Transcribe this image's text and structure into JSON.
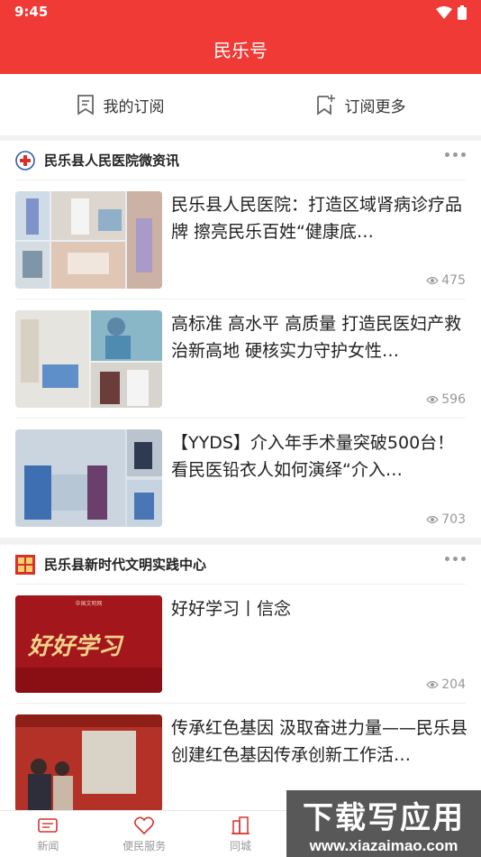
{
  "status": {
    "time": "9:45"
  },
  "app": {
    "title": "民乐号"
  },
  "subscribe": {
    "mine": "我的订阅",
    "more": "订阅更多"
  },
  "sections": [
    {
      "name": "民乐县人民医院微资讯",
      "items": [
        {
          "title": "民乐县人民医院：打造区域肾病诊疗品牌 擦亮民乐百姓“健康底…",
          "views": "475"
        },
        {
          "title": "高标准 高水平 高质量 打造民医妇产救治新高地 硬核实力守护女性…",
          "views": "596"
        },
        {
          "title": "【YYDS】介入年手术量突破500台！看民医铅衣人如何演绎“介入…",
          "views": "703"
        }
      ]
    },
    {
      "name": "民乐县新时代文明实践中心",
      "items": [
        {
          "title": "好好学习丨信念",
          "views": "204",
          "thumb_text": "好好学习",
          "thumb_caption": "中国文明网"
        },
        {
          "title": "传承红色基因 汲取奋进力量——民乐县创建红色基因传承创新工作活…",
          "views": ""
        }
      ]
    }
  ],
  "tabs": [
    {
      "label": "新闻"
    },
    {
      "label": "便民服务"
    },
    {
      "label": "同城"
    },
    {
      "label": ""
    },
    {
      "label": ""
    }
  ],
  "watermark": {
    "line1": "下载写应用",
    "line2": "www.xiazaimao.com"
  },
  "colors": {
    "brand": "#ef3a36",
    "text": "#222222",
    "muted": "#999999"
  }
}
